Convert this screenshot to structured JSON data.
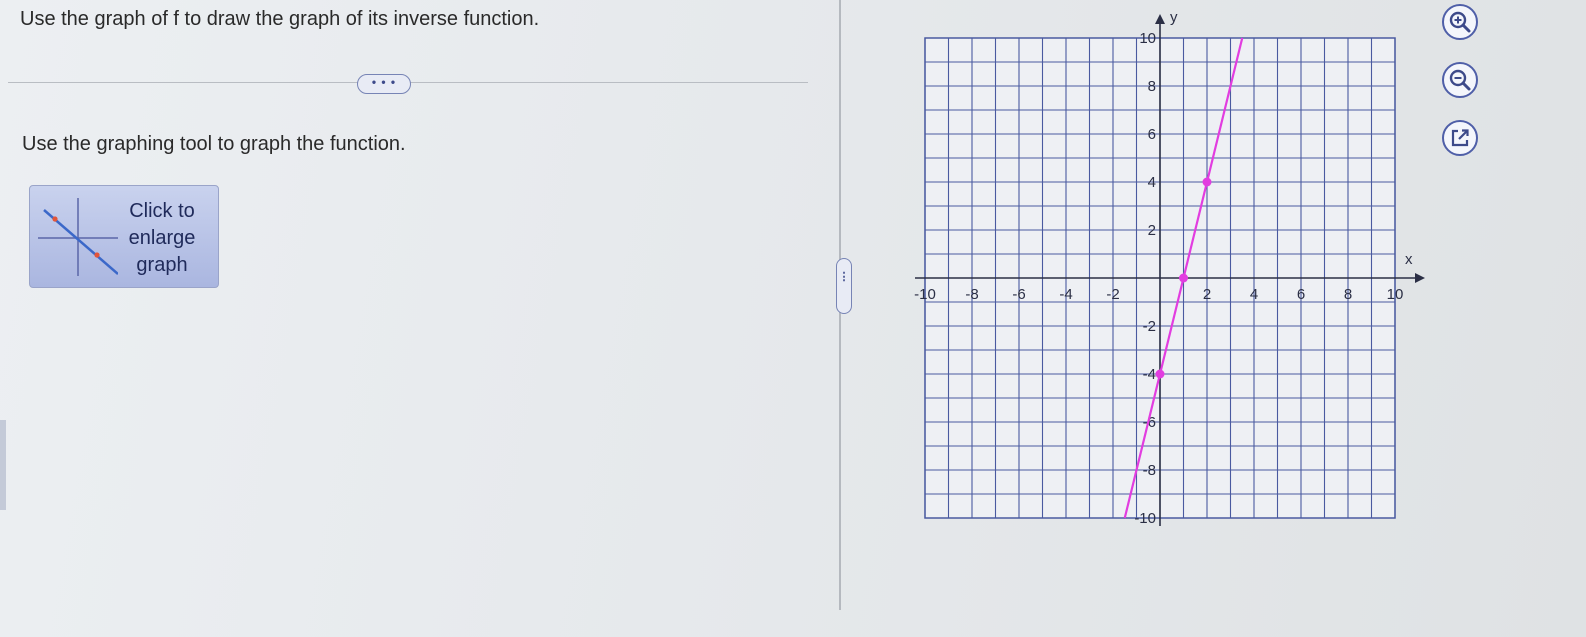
{
  "question": {
    "text": "Use the graph of f to draw the graph of its inverse function."
  },
  "more_button": {
    "label": "• • •"
  },
  "instruction": {
    "text": "Use the graphing tool to graph the function."
  },
  "enlarge_card": {
    "lines": [
      "Click to",
      "enlarge",
      "graph"
    ]
  },
  "splitter": {
    "label": "⋮"
  },
  "graph": {
    "x_axis_label": "x",
    "y_axis_label": "y",
    "x_ticks": [
      "-10",
      "-8",
      "-6",
      "-4",
      "-2",
      "2",
      "4",
      "6",
      "8",
      "10"
    ],
    "y_ticks": [
      "10",
      "8",
      "6",
      "4",
      "2",
      "-2",
      "-4",
      "-6",
      "-8",
      "-10"
    ],
    "x_range": [
      -10,
      10
    ],
    "y_range": [
      -10,
      10
    ],
    "grid_step": 1,
    "line_color": "#e23de0",
    "function_line": {
      "slope": 4,
      "intercept": -4
    },
    "points": [
      {
        "x": 0,
        "y": -4
      },
      {
        "x": 1,
        "y": 0
      },
      {
        "x": 2,
        "y": 4
      }
    ]
  },
  "tools": [
    {
      "name": "zoom-in-icon"
    },
    {
      "name": "zoom-out-icon"
    },
    {
      "name": "popout-icon"
    }
  ],
  "accent_color": "#4f5fa8"
}
